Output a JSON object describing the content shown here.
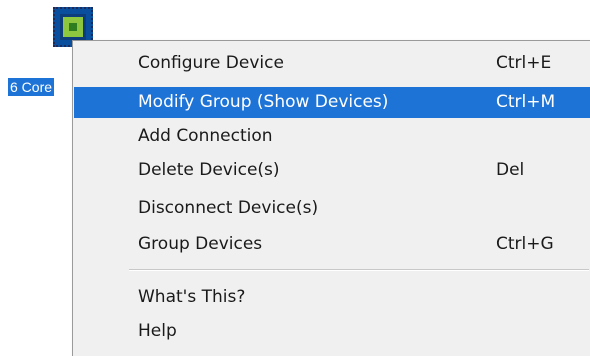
{
  "desktop": {
    "device_icon": "device-chip-icon",
    "device_label": "6 Core"
  },
  "context_menu": {
    "items": [
      {
        "label": "Configure Device",
        "shortcut": "Ctrl+E"
      },
      {
        "label": "Modify Group (Show Devices)",
        "shortcut": "Ctrl+M"
      },
      {
        "label": "Add Connection",
        "shortcut": ""
      },
      {
        "label": "Delete Device(s)",
        "shortcut": "Del"
      },
      {
        "label": "Disconnect Device(s)",
        "shortcut": ""
      },
      {
        "label": "Group Devices",
        "shortcut": "Ctrl+G"
      },
      {
        "label": "What's This?",
        "shortcut": ""
      },
      {
        "label": "Help",
        "shortcut": ""
      }
    ],
    "highlighted_item": "Modify Group (Show Devices)"
  },
  "colors": {
    "selection": "#1e73d6",
    "menu_background": "#f0f0f0",
    "icon_fill": "#0a4f9e",
    "icon_core": "#8dc63f"
  }
}
